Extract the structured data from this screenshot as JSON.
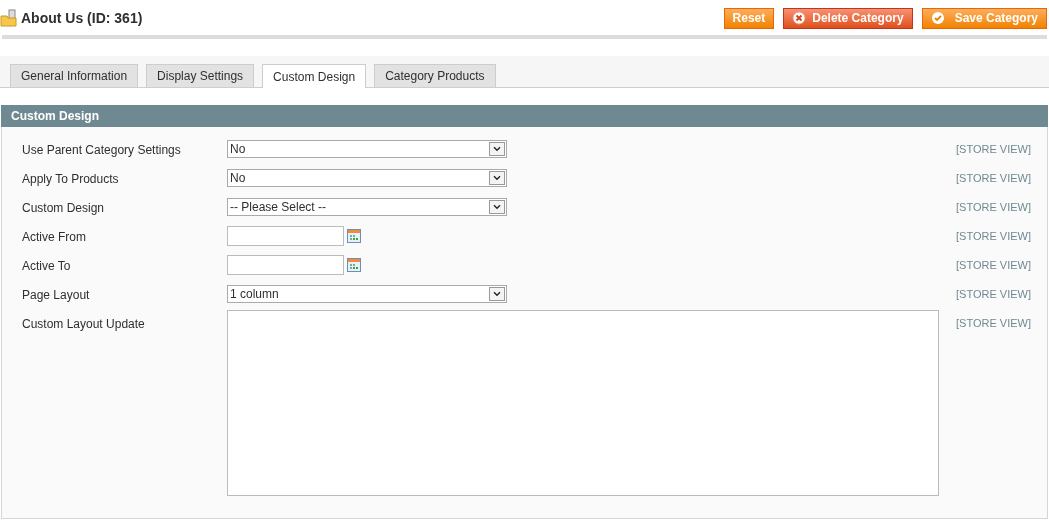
{
  "page_title": "About Us (ID: 361)",
  "buttons": [
    {
      "label": "Reset",
      "kind": "reset"
    },
    {
      "label": "Delete Category",
      "kind": "delete"
    },
    {
      "label": "Save Category",
      "kind": "save"
    }
  ],
  "tabs": [
    {
      "label": "General Information",
      "selected": false
    },
    {
      "label": "Display Settings",
      "selected": false
    },
    {
      "label": "Custom Design",
      "selected": true
    },
    {
      "label": "Category Products",
      "selected": false
    }
  ],
  "section": {
    "title": "Custom Design",
    "fields": [
      {
        "label": "Use Parent Category Settings",
        "kind": "select",
        "value": "No",
        "scope": "[STORE VIEW]"
      },
      {
        "label": "Apply To Products",
        "kind": "select",
        "value": "No",
        "scope": "[STORE VIEW]"
      },
      {
        "label": "Custom Design",
        "kind": "select",
        "value": "-- Please Select --",
        "scope": "[STORE VIEW]"
      },
      {
        "label": "Active From",
        "kind": "date",
        "scope": "[STORE VIEW]"
      },
      {
        "label": "Active To",
        "kind": "date",
        "scope": "[STORE VIEW]"
      },
      {
        "label": "Page Layout",
        "kind": "select",
        "value": "1 column",
        "scope": "[STORE VIEW]"
      },
      {
        "label": "Custom Layout Update",
        "kind": "textarea",
        "scope": "[STORE VIEW]"
      }
    ]
  }
}
